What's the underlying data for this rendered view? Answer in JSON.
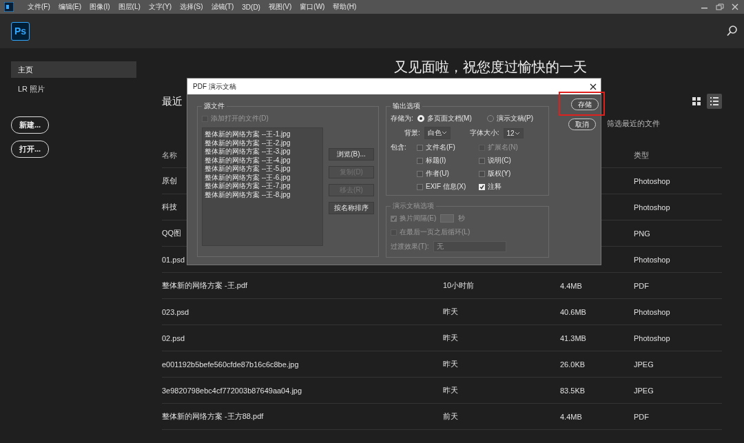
{
  "menubar": {
    "items": [
      "文件(F)",
      "编辑(E)",
      "图像(I)",
      "图层(L)",
      "文字(Y)",
      "选择(S)",
      "滤镜(T)",
      "3D(D)",
      "视图(V)",
      "窗口(W)",
      "帮助(H)"
    ]
  },
  "header": {
    "logo": "Ps"
  },
  "sidebar": {
    "items": [
      {
        "label": "主页",
        "selected": true
      },
      {
        "label": "LR 照片",
        "selected": false
      }
    ],
    "buttons": [
      "新建...",
      "打开..."
    ]
  },
  "main": {
    "greeting": "又见面啦，祝您度过愉快的一天",
    "section_title": "最近",
    "filter_label": "筛选最近的文件",
    "view_toggles": [
      {
        "kind": "grid",
        "selected": false
      },
      {
        "kind": "list",
        "selected": true
      }
    ],
    "table": {
      "header": {
        "name": "名称",
        "type": "类型"
      },
      "rows": [
        {
          "name": "原创",
          "type": "Photoshop"
        },
        {
          "name": "科技",
          "type": "Photoshop"
        },
        {
          "name": "QQ图",
          "type": "PNG"
        },
        {
          "name": "01.psd",
          "type": "Photoshop"
        },
        {
          "name": "整体新的网络方案 -王.pdf",
          "modified": "10小时前",
          "size": "4.4MB",
          "type": "PDF"
        },
        {
          "name": "023.psd",
          "modified": "昨天",
          "size": "40.6MB",
          "type": "Photoshop"
        },
        {
          "name": "02.psd",
          "modified": "昨天",
          "size": "41.3MB",
          "type": "Photoshop"
        },
        {
          "name": "e001192b5befe560cfde87b16c6c8be.jpg",
          "modified": "昨天",
          "size": "26.0KB",
          "type": "JPEG"
        },
        {
          "name": "3e9820798ebc4cf772003b87649aa04.jpg",
          "modified": "昨天",
          "size": "83.5KB",
          "type": "JPEG"
        },
        {
          "name": "整体新的网络方案 -王方88.pdf",
          "modified": "前天",
          "size": "4.4MB",
          "type": "PDF"
        }
      ]
    }
  },
  "dialog": {
    "title": "PDF 演示文稿",
    "source": {
      "legend": "源文件",
      "add_open": {
        "label": "添加打开的文件(D)",
        "checked": false,
        "disabled": true
      },
      "files": [
        "整体新的网络方案 --王-1.jpg",
        "整体新的网络方案 --王-2.jpg",
        "整体新的网络方案 --王-3.jpg",
        "整体新的网络方案 --王-4.jpg",
        "整体新的网络方案 --王-5.jpg",
        "整体新的网络方案 --王-6.jpg",
        "整体新的网络方案 --王-7.jpg",
        "整体新的网络方案 --王-8.jpg"
      ],
      "buttons": [
        {
          "label": "浏览(B)...",
          "disabled": false
        },
        {
          "label": "复制(D)",
          "disabled": true
        },
        {
          "label": "移去(R)",
          "disabled": true
        },
        {
          "label": "按名称排序",
          "disabled": false
        }
      ]
    },
    "output": {
      "legend": "输出选项",
      "save_as_label": "存储为:",
      "save_as": [
        {
          "label": "多页面文档(M)",
          "selected": true
        },
        {
          "label": "演示文稿(P)",
          "selected": false
        }
      ],
      "background": {
        "label": "背景:",
        "value": "白色"
      },
      "font_size": {
        "label": "字体大小:",
        "value": "12"
      },
      "include_label": "包含:",
      "include": [
        {
          "label": "文件名(F)",
          "checked": false,
          "disabled": false
        },
        {
          "label": "扩展名(N)",
          "checked": false,
          "disabled": true
        },
        {
          "label": "标题(I)",
          "checked": false,
          "disabled": false
        },
        {
          "label": "说明(C)",
          "checked": false,
          "disabled": false
        },
        {
          "label": "作者(U)",
          "checked": false,
          "disabled": false
        },
        {
          "label": "版权(Y)",
          "checked": false,
          "disabled": false
        },
        {
          "label": "EXIF 信息(X)",
          "checked": false,
          "disabled": false
        },
        {
          "label": "注释",
          "checked": true,
          "disabled": false
        }
      ]
    },
    "presentation": {
      "legend": "演示文稿选项",
      "disabled": true,
      "advance": {
        "label": "换片间隔(E)",
        "checked": true
      },
      "unit": "秒",
      "loop": {
        "label": "在最后一页之后循环(L)",
        "checked": false
      },
      "transition": {
        "label": "过渡效果(T):",
        "value": "无"
      }
    },
    "buttons": [
      {
        "label": "存储",
        "highlighted": true
      },
      {
        "label": "取消",
        "highlighted": false
      }
    ]
  }
}
